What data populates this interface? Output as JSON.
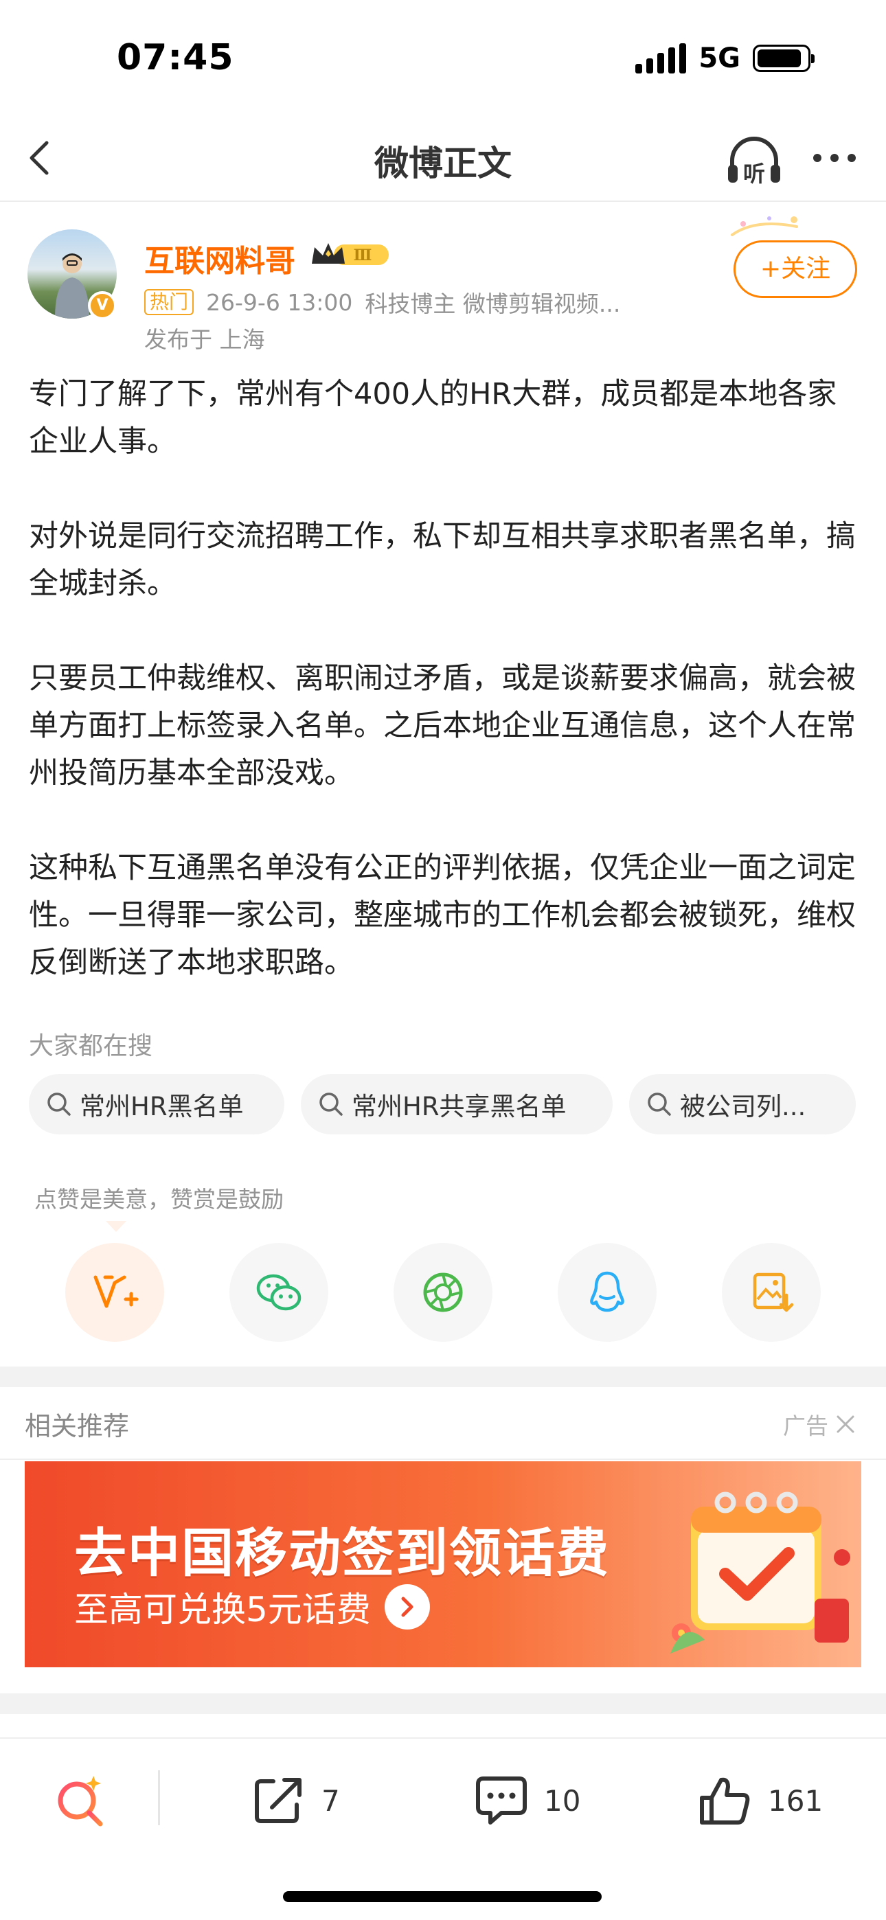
{
  "status_bar": {
    "time": "07:45",
    "network": "5G",
    "battery_level": 0.9
  },
  "nav": {
    "title": "微博正文",
    "back_icon": "chevron-left-icon",
    "listen_icon": "headphone-listen-icon",
    "listen_label": "听",
    "more_icon": "more-dots-icon"
  },
  "author": {
    "name": "互联网料哥",
    "level_badge": "Ⅲ",
    "verified_badge": "V",
    "hot_tag": "热门",
    "timestamp": "26-9-6 13:00",
    "tags": "科技博主 微博剪辑视频...",
    "location": "发布于 上海",
    "follow_label": "+关注"
  },
  "post": {
    "paragraphs": [
      "专门了解了下，常州有个400人的HR大群，成员都是本地各家企业人事。",
      "对外说是同行交流招聘工作，私下却互相共享求职者黑名单，搞全城封杀。",
      "只要员工仲裁维权、离职闹过矛盾，或是谈薪要求偏高，就会被单方面打上标签录入名单。之后本地企业互通信息，这个人在常州投简历基本全部没戏。",
      "这种私下互通黑名单没有公正的评判依据，仅凭企业一面之词定性。一旦得罪一家公司，整座城市的工作机会都会被锁死，维权反倒断送了本地求职路。"
    ]
  },
  "search": {
    "title": "大家都在搜",
    "chips": [
      "常州HR黑名单",
      "常州HR共享黑名单",
      "被公司列..."
    ]
  },
  "share": {
    "encourage_text": "点赞是美意，赞赏是鼓励",
    "items": [
      "reward-v-icon",
      "wechat-icon",
      "moments-icon",
      "qq-icon",
      "save-image-icon"
    ]
  },
  "recommend": {
    "title": "相关推荐",
    "ad_label": "广告",
    "banner_title": "去中国移动签到领话费",
    "banner_subtitle": "至高可兑换5元话费"
  },
  "bottom_bar": {
    "repost_count": "7",
    "comment_count": "10",
    "like_count": "161"
  },
  "colors": {
    "accent": "#ff8200",
    "name": "#ff6a00",
    "banner": "#f04a2a"
  }
}
